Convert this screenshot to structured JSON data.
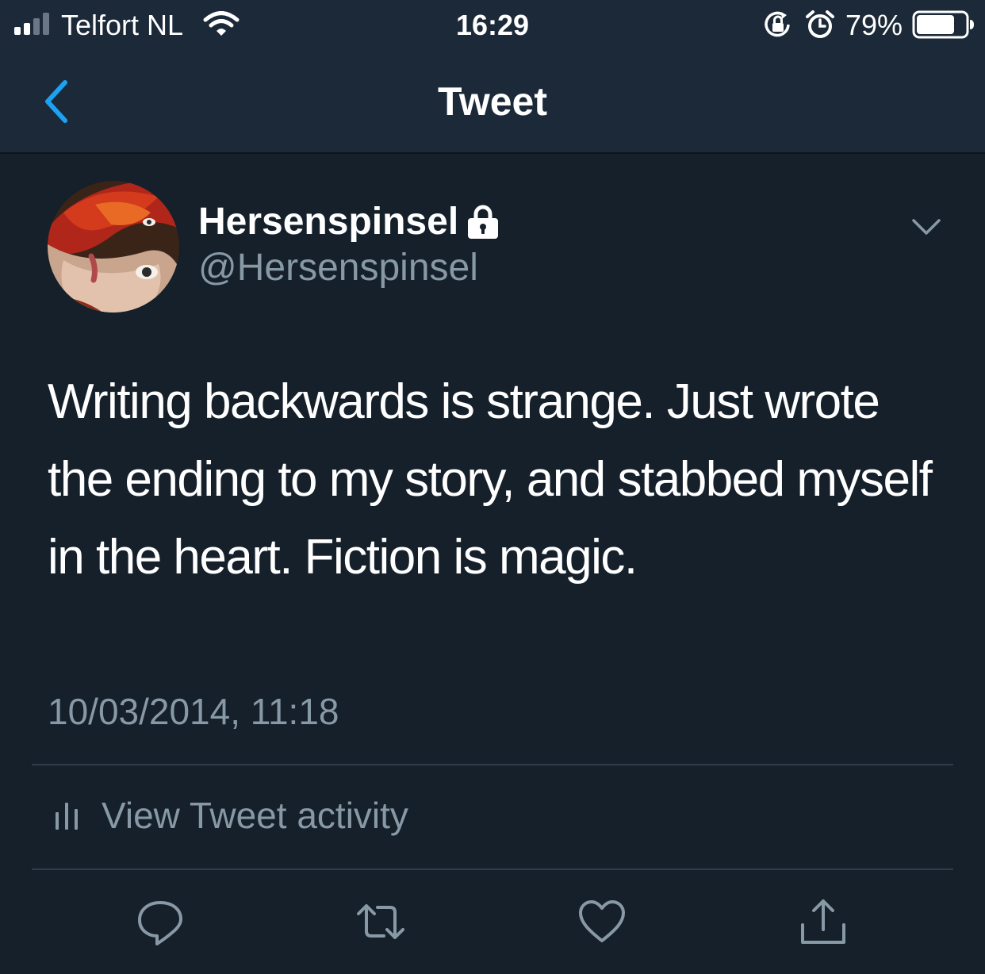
{
  "status_bar": {
    "carrier": "Telfort NL",
    "time": "16:29",
    "battery_percent": "79%",
    "battery_level": 0.79,
    "icons": [
      "signal-icon",
      "wifi-icon",
      "orientation-lock-icon",
      "alarm-icon",
      "battery-icon"
    ]
  },
  "nav": {
    "title": "Tweet",
    "back_icon": "chevron-left-icon"
  },
  "tweet": {
    "display_name": "Hersenspinsel",
    "handle": "@Hersenspinsel",
    "protected_icon": "lock-icon",
    "text": "Writing backwards is strange. Just wrote the ending to my story, and stabbed myself in the heart. Fiction is magic.",
    "timestamp": "10/03/2014, 11:18"
  },
  "activity": {
    "label": "View Tweet activity",
    "icon": "bar-chart-icon"
  },
  "actions": {
    "icons": [
      "reply-icon",
      "retweet-icon",
      "like-icon",
      "share-icon"
    ]
  },
  "colors": {
    "background": "#15202b",
    "bar_background": "#1c2938",
    "accent": "#1da1f2",
    "secondary_text": "#8899a6",
    "divider": "#2f3d4a"
  }
}
